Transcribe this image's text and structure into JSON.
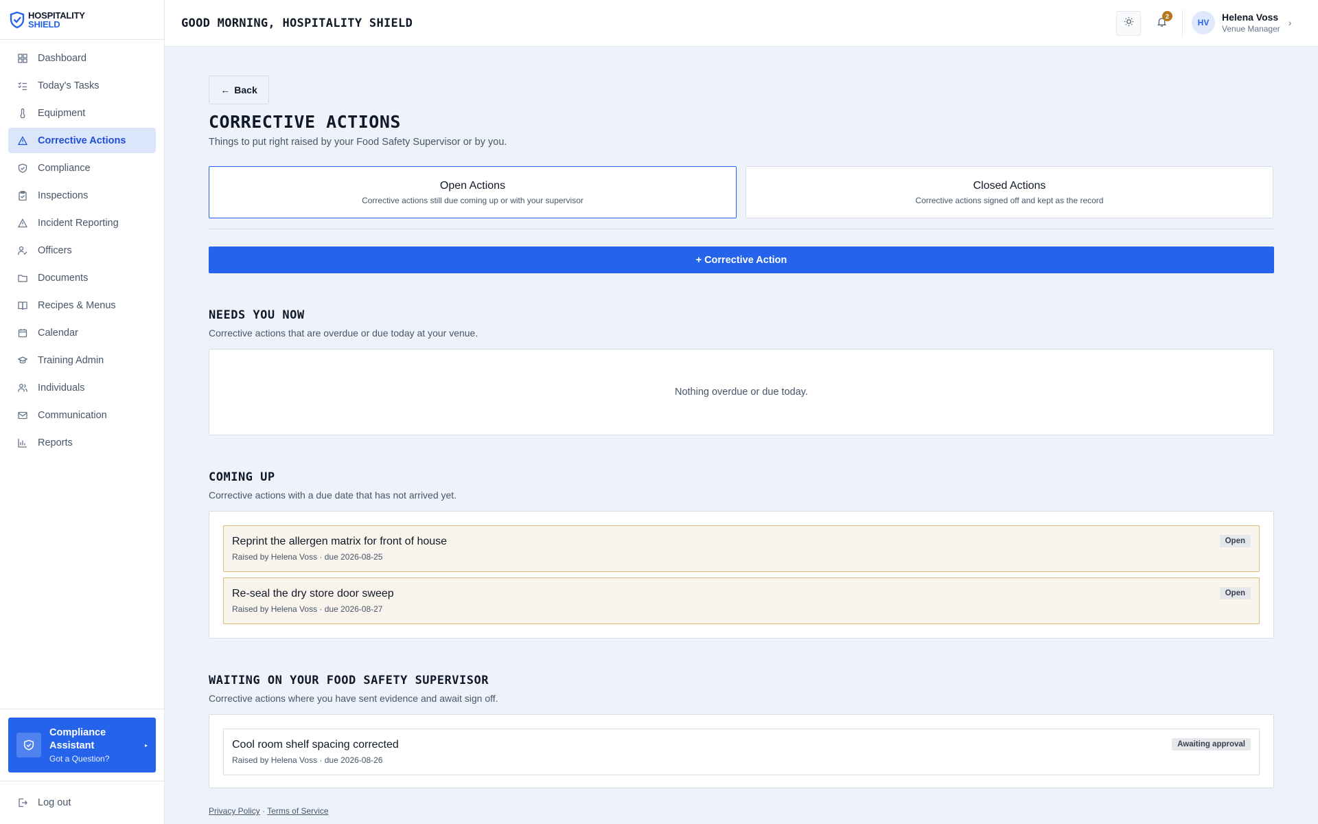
{
  "brand": {
    "line1": "HOSPITALITY",
    "line2": "SHIELD"
  },
  "header": {
    "greeting": "GOOD MORNING, HOSPITALITY SHIELD",
    "notification_count": "2",
    "user": {
      "initials": "HV",
      "name": "Helena Voss",
      "role": "Venue Manager"
    }
  },
  "sidebar": {
    "items": [
      {
        "label": "Dashboard",
        "icon": "grid-icon"
      },
      {
        "label": "Today's Tasks",
        "icon": "checklist-icon"
      },
      {
        "label": "Equipment",
        "icon": "thermometer-icon"
      },
      {
        "label": "Corrective Actions",
        "icon": "warning-triangle-icon",
        "active": true
      },
      {
        "label": "Compliance",
        "icon": "shield-check-icon"
      },
      {
        "label": "Inspections",
        "icon": "clipboard-check-icon"
      },
      {
        "label": "Incident Reporting",
        "icon": "alert-triangle-icon"
      },
      {
        "label": "Officers",
        "icon": "user-check-icon"
      },
      {
        "label": "Documents",
        "icon": "folder-icon"
      },
      {
        "label": "Recipes & Menus",
        "icon": "book-open-icon"
      },
      {
        "label": "Calendar",
        "icon": "calendar-icon"
      },
      {
        "label": "Training Admin",
        "icon": "graduation-cap-icon"
      },
      {
        "label": "Individuals",
        "icon": "users-icon"
      },
      {
        "label": "Communication",
        "icon": "mail-icon"
      },
      {
        "label": "Reports",
        "icon": "bar-chart-icon"
      }
    ],
    "assistant": {
      "title": "Compliance Assistant",
      "subtitle": "Got a Question?"
    },
    "logout": "Log out"
  },
  "main": {
    "back_label": "Back",
    "title": "CORRECTIVE ACTIONS",
    "subtitle": "Things to put right raised by your Food Safety Supervisor or by you.",
    "tabs": [
      {
        "label": "Open Actions",
        "desc": "Corrective actions still due coming up or with your supervisor",
        "active": true
      },
      {
        "label": "Closed Actions",
        "desc": "Corrective actions signed off and kept as the record",
        "active": false
      }
    ],
    "add_button": "+ Corrective Action",
    "sections": {
      "needs_now": {
        "title": "NEEDS YOU NOW",
        "subtitle": "Corrective actions that are overdue or due today at your venue.",
        "empty": "Nothing overdue or due today."
      },
      "coming_up": {
        "title": "COMING UP",
        "subtitle": "Corrective actions with a due date that has not arrived yet.",
        "items": [
          {
            "title": "Reprint the allergen matrix for front of house",
            "meta": "Raised by Helena Voss · due 2026-08-25",
            "status": "Open"
          },
          {
            "title": "Re-seal the dry store door sweep",
            "meta": "Raised by Helena Voss · due 2026-08-27",
            "status": "Open"
          }
        ]
      },
      "waiting": {
        "title": "WAITING ON YOUR FOOD SAFETY SUPERVISOR",
        "subtitle": "Corrective actions where you have sent evidence and await sign off.",
        "items": [
          {
            "title": "Cool room shelf spacing corrected",
            "meta": "Raised by Helena Voss · due 2026-08-26",
            "status": "Awaiting approval"
          }
        ]
      }
    },
    "footer": {
      "privacy": "Privacy Policy",
      "separator": "·",
      "terms": "Terms of Service"
    }
  },
  "colors": {
    "accent": "#2563eb",
    "amber_card_bg": "#f9f4ec",
    "amber_card_border": "#ddb77a",
    "badge": "#b7791f"
  }
}
